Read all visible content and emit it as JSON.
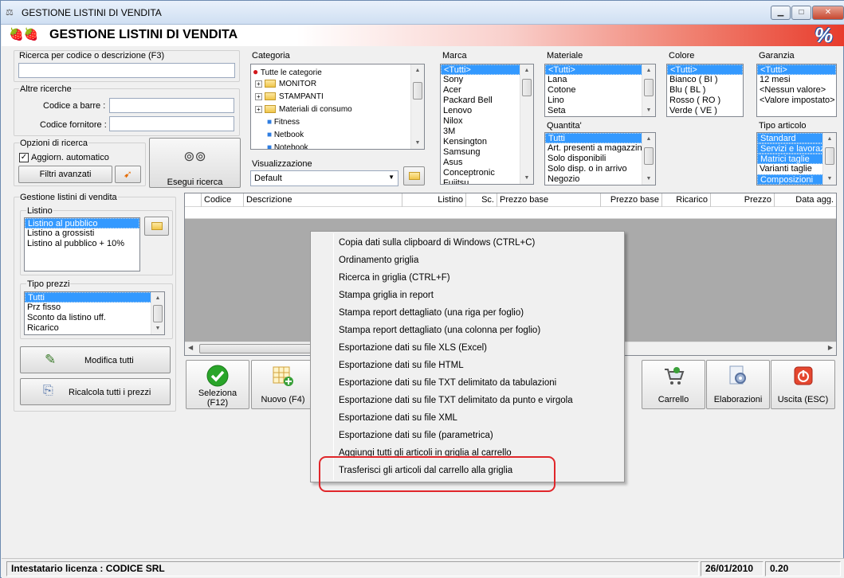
{
  "window": {
    "title": "GESTIONE LISTINI DI VENDITA",
    "banner_title": "GESTIONE LISTINI DI VENDITA",
    "banner_logo": "%",
    "controls": [
      "minimize",
      "maximize",
      "close"
    ]
  },
  "search": {
    "code_desc_label": "Ricerca per codice o descrizione (F3)",
    "code_desc_value": "",
    "other_label": "Altre ricerche",
    "barcode_label": "Codice a barre :",
    "supplier_code_label": "Codice fornitore :",
    "options_label": "Opzioni di ricerca",
    "auto_update_label": "Aggiorn. automatico",
    "auto_update_checked": true,
    "advanced_filters_label": "Filtri avanzati",
    "run_search_label": "Esegui ricerca"
  },
  "category": {
    "label": "Categoria",
    "items": [
      {
        "label": "Tutte le categorie",
        "icon": "strawberry-icon",
        "level": 0
      },
      {
        "label": "MONITOR",
        "icon": "folder-icon",
        "level": 1
      },
      {
        "label": "STAMPANTI",
        "icon": "folder-icon",
        "level": 1
      },
      {
        "label": "Materiali di consumo",
        "icon": "folder-icon",
        "level": 1
      },
      {
        "label": "Fitness",
        "icon": "blocks-icon",
        "level": 1
      },
      {
        "label": "Netbook",
        "icon": "blocks-icon",
        "level": 1
      },
      {
        "label": "Notebook",
        "icon": "blocks-icon",
        "level": 1
      }
    ]
  },
  "view": {
    "label": "Visualizzazione",
    "selected": "Default"
  },
  "brand": {
    "label": "Marca",
    "items": [
      "<Tutti>",
      "Sony",
      "Acer",
      "Packard Bell",
      "Lenovo",
      "Nilox",
      "3M",
      "Kensington",
      "Samsung",
      "Asus",
      "Conceptronic",
      "Fujitsu"
    ],
    "selected": 0
  },
  "material": {
    "label": "Materiale",
    "items": [
      "<Tutti>",
      "Lana",
      "Cotone",
      "Lino",
      "Seta"
    ],
    "selected": 0
  },
  "color": {
    "label": "Colore",
    "items": [
      "<Tutti>",
      "Bianco ( BI )",
      "Blu ( BL )",
      "Rosso ( RO )",
      "Verde ( VE )"
    ],
    "selected": 0
  },
  "warranty": {
    "label": "Garanzia",
    "items": [
      "<Tutti>",
      "12 mesi",
      "<Nessun valore>",
      "<Valore impostato>"
    ],
    "selected": 0
  },
  "quantity": {
    "label": "Quantita'",
    "items": [
      "Tutti",
      "Art. presenti a magazzino",
      "Solo disponibili",
      "Solo disp. o in arrivo",
      "Negozio"
    ],
    "selected": 0
  },
  "item_type": {
    "label": "Tipo articolo",
    "items": [
      "Standard",
      "Servizi e lavoraz",
      "Matrici taglie",
      "Varianti taglie",
      "Composizioni"
    ],
    "selected": [
      0,
      1,
      2,
      4
    ]
  },
  "pricelist_mgmt": {
    "label": "Gestione listini di vendita",
    "list_label": "Listino",
    "lists": [
      "Listino al pubblico",
      "Listino a grossisti",
      "Listino al pubblico + 10%"
    ],
    "selected": 0,
    "price_type_label": "Tipo prezzi",
    "price_types": [
      "Tutti",
      "Prz fisso",
      "Sconto da listino uff.",
      "Ricarico"
    ],
    "price_type_selected": 0,
    "modify_all_label": "Modifica tutti",
    "recalc_label": "Ricalcola tutti i prezzi"
  },
  "grid": {
    "columns": [
      "Codice",
      "Descrizione",
      "Listino",
      "Sc.",
      "Prezzo base",
      "Prezzo base",
      "Ricarico",
      "Prezzo",
      "Data agg."
    ]
  },
  "toolbar": {
    "select_label": "Seleziona\n(F12)",
    "select_line1": "Seleziona",
    "select_line2": "(F12)",
    "new_label": "Nuovo (F4)",
    "cart_label": "Carrello",
    "processing_label": "Elaborazioni",
    "exit_label": "Uscita (ESC)"
  },
  "context_menu": {
    "items": [
      "Copia dati sulla clipboard di Windows (CTRL+C)",
      "Ordinamento griglia",
      "Ricerca in griglia (CTRL+F)",
      "Stampa griglia in report",
      "Stampa report dettagliato (una riga per foglio)",
      "Stampa report dettagliato (una colonna per foglio)",
      "Esportazione dati su file XLS (Excel)",
      "Esportazione dati su file HTML",
      "Esportazione dati su file TXT delimitato da tabulazioni",
      "Esportazione dati su file TXT delimitato da punto e virgola",
      "Esportazione dati su file XML",
      "Esportazione dati su file (parametrica)",
      "Aggiungi tutti gli articoli in griglia al carrello",
      "Trasferisci gli articoli dal carrello alla griglia"
    ],
    "highlighted_index": 13
  },
  "status_bar": {
    "license": "Intestatario licenza : CODICE SRL",
    "date": "26/01/2010",
    "version": "0.20"
  },
  "colors": {
    "selection": "#3399ff",
    "annotation_red": "#e0262a",
    "banner_red": "#e83c2c"
  }
}
